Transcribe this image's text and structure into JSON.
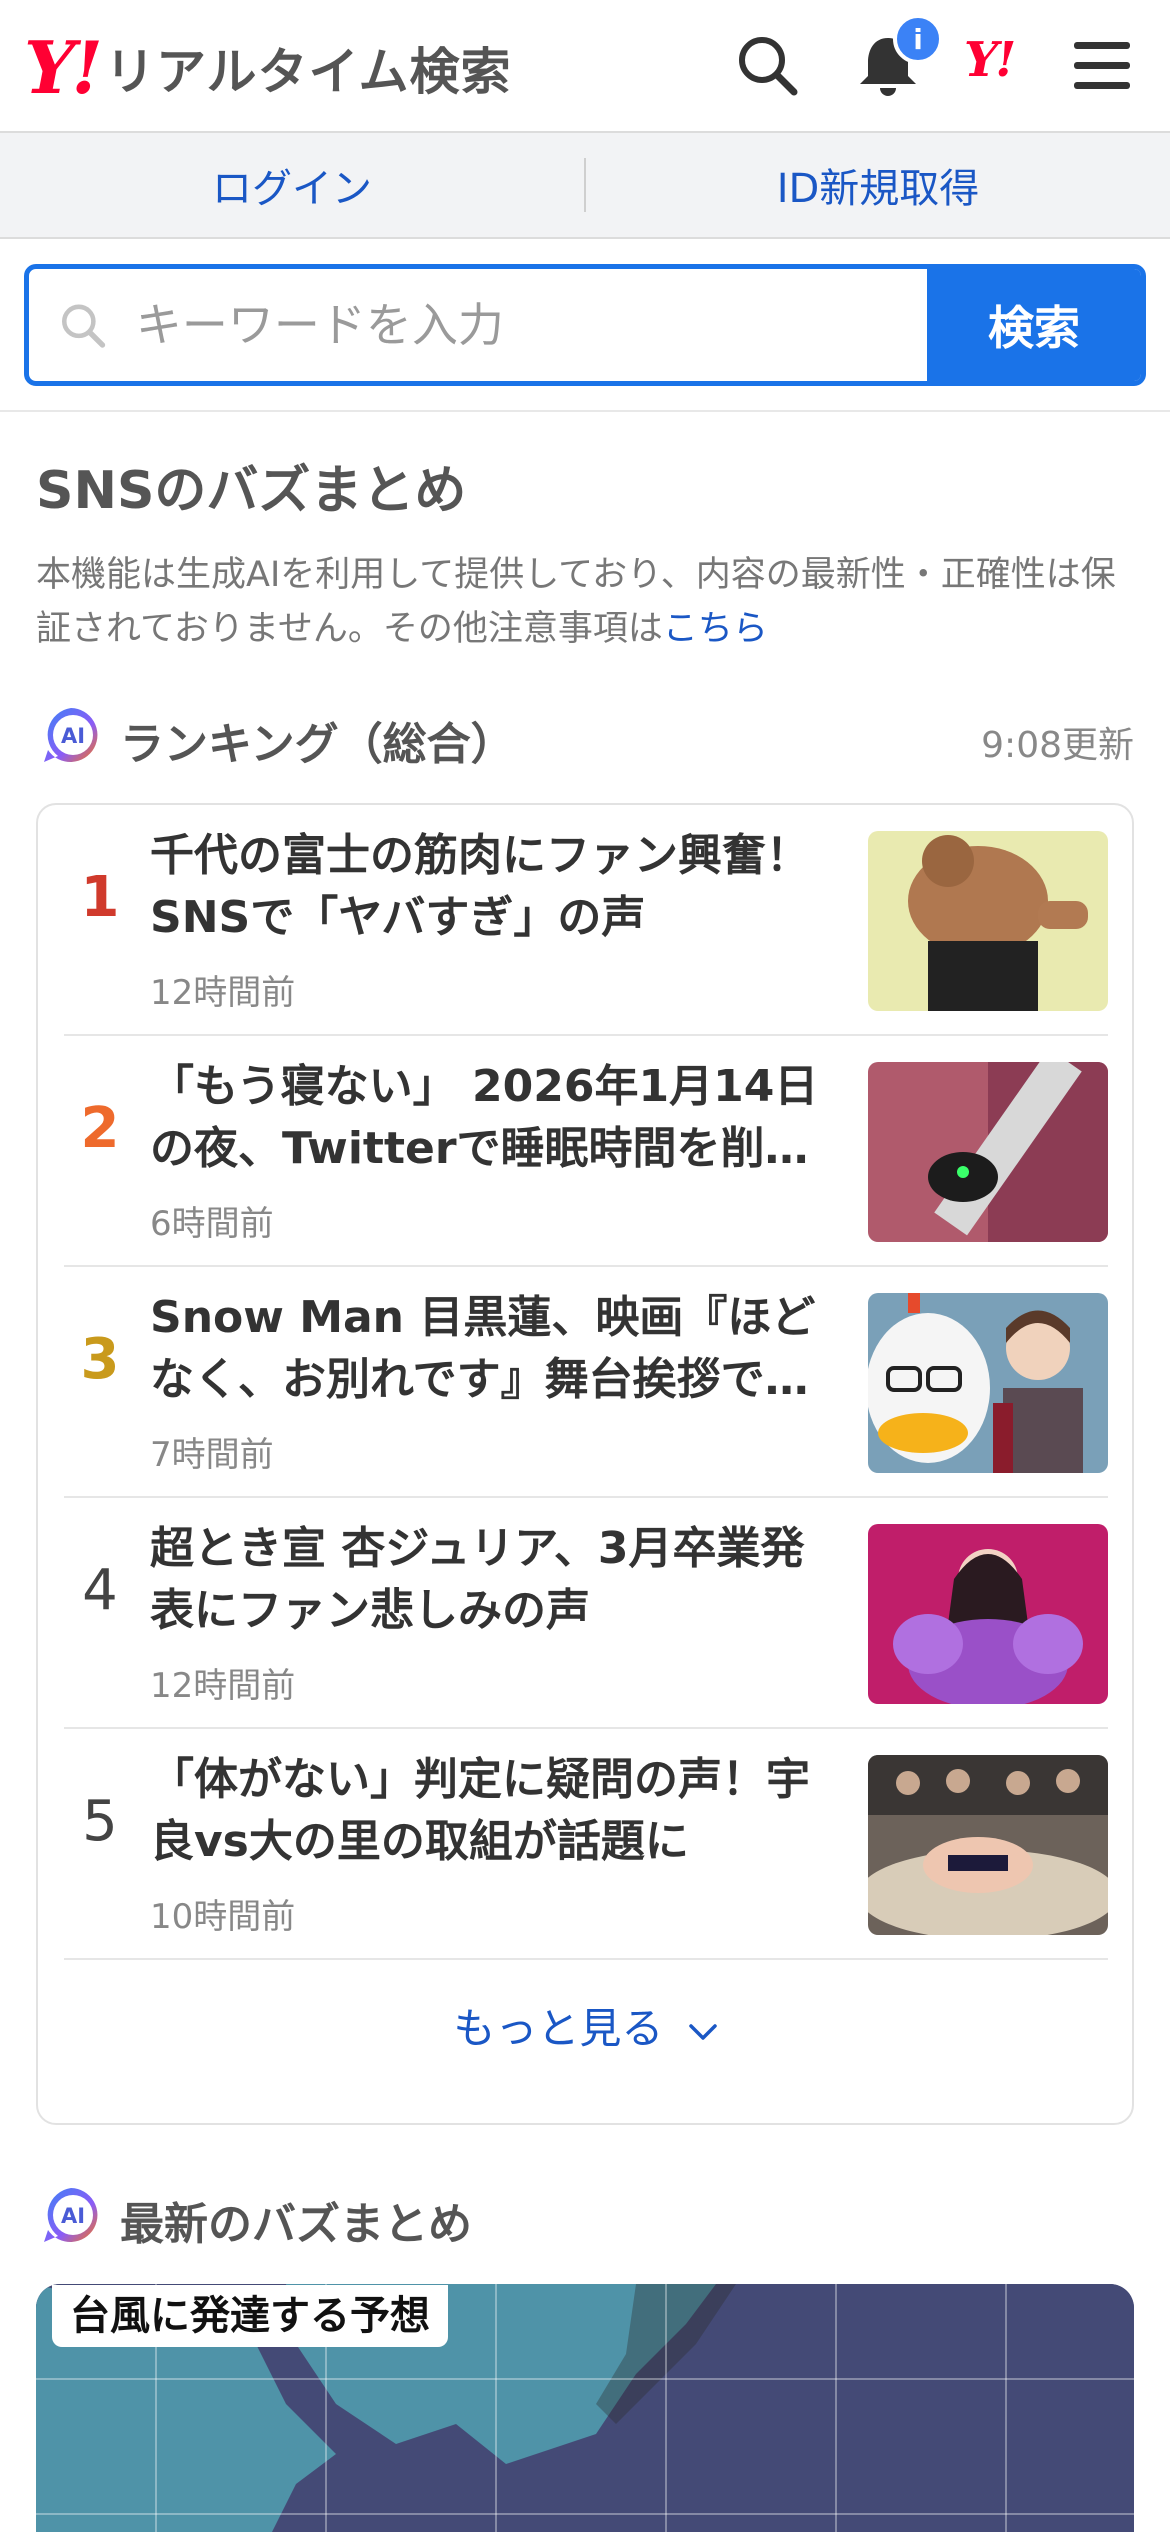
{
  "header": {
    "logo_mark": "Y!",
    "logo_text": "リアルタイム検索",
    "notification_badge": "i",
    "yjapan_mark": "Y!"
  },
  "login_bar": {
    "login": "ログイン",
    "signup": "ID新規取得"
  },
  "search": {
    "placeholder": "キーワードを入力",
    "button": "検索"
  },
  "section": {
    "title": "SNSのバズまとめ",
    "disclaimer_text": "本機能は生成AIを利用して提供しており、内容の最新性・正確性は保証されておりません。その他注意事項は",
    "disclaimer_link": "こちら"
  },
  "ranking": {
    "ai_badge": "AI",
    "title": "ランキング（総合）",
    "updated": "9:08更新",
    "more": "もっと見る",
    "items": [
      {
        "rank": "1",
        "title": "千代の富士の筋肉にファン興奮！SNSで「ヤバすぎ」の声",
        "time": "12時間前",
        "color": "#d03a2c"
      },
      {
        "rank": "2",
        "title": "「もう寝ない」 2026年1月14日の夜、Twitterで睡眠時間を削…",
        "time": "6時間前",
        "color": "#ee6a2c"
      },
      {
        "rank": "3",
        "title": "Snow Man 目黒蓮、映画『ほどなく、お別れです』舞台挨拶で…",
        "time": "7時間前",
        "color": "#c99a1c"
      },
      {
        "rank": "4",
        "title": "超とき宣 杏ジュリア、3月卒業発表にファン悲しみの声",
        "time": "12時間前",
        "color": "#444444"
      },
      {
        "rank": "5",
        "title": "「体がない」判定に疑問の声！宇良vs大の里の取組が話題に",
        "time": "10時間前",
        "color": "#444444"
      }
    ]
  },
  "latest": {
    "ai_badge": "AI",
    "title": "最新のバズまとめ",
    "card_label": "台風に発達する予想"
  },
  "colors": {
    "accent": "#1a73e8",
    "link": "#1a57c5",
    "brand_red": "#ff0033"
  }
}
